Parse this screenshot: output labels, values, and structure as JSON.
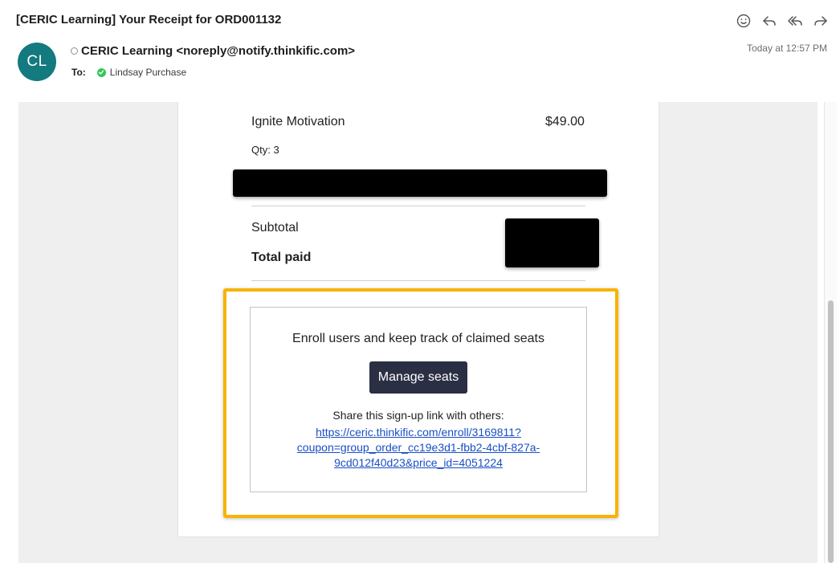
{
  "email": {
    "subject": "[CERIC Learning] Your Receipt for ORD001132",
    "avatar_initials": "CL",
    "from": "CERIC Learning <noreply@notify.thinkific.com>",
    "to_label": "To:",
    "recipient": "Lindsay Purchase",
    "timestamp": "Today at 12:57 PM"
  },
  "toolbar": {
    "icons": [
      "emoji-icon",
      "reply-icon",
      "reply-all-icon",
      "forward-icon"
    ]
  },
  "receipt": {
    "item_name": "Ignite Motivation",
    "item_price": "$49.00",
    "item_qty": "Qty: 3",
    "subtotal_label": "Subtotal",
    "total_label": "Total paid"
  },
  "seats": {
    "heading": "Enroll users and keep track of claimed seats",
    "button_label": "Manage seats",
    "share_text": "Share this sign-up link with others:",
    "link_lines": [
      "https://ceric.thinkific.com/enroll/3169811?",
      "coupon=group_order_cc19e3d1-fbb2-4cbf-827a-",
      "9cd012f40d23&price_id=4051224"
    ]
  },
  "colors": {
    "avatar_bg": "#137a7f",
    "highlight_border": "#f6b400",
    "button_bg": "#2b2f44",
    "link": "#1a4fc4",
    "status_green": "#34c759"
  }
}
